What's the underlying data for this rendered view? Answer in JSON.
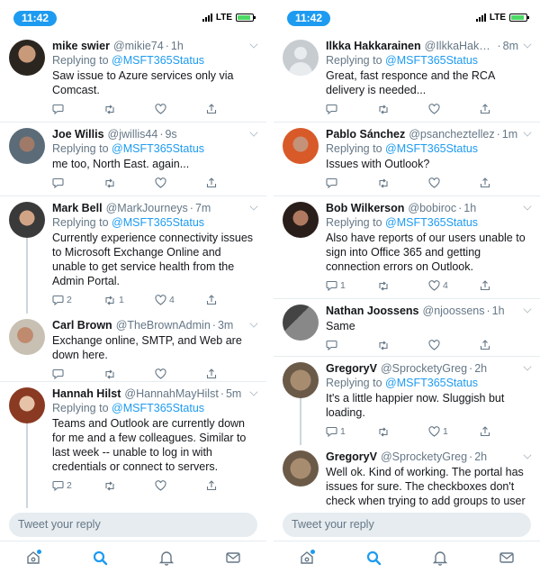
{
  "status": {
    "time": "11:42",
    "network": "LTE",
    "battery_level": 0.9
  },
  "colors": {
    "accent": "#1d9bf0",
    "muted": "#657786",
    "text": "#14171a",
    "divider": "#e6ecf0"
  },
  "left": {
    "tweets": [
      {
        "name": "mike swier",
        "handle": "@mikie74",
        "age": "1h",
        "replying_prefix": "Replying to",
        "mention": "@MSFT365Status",
        "text": "Saw issue to Azure services only via Comcast.",
        "counts": {
          "reply": "",
          "retweet": "",
          "like": ""
        }
      },
      {
        "name": "Joe Willis",
        "handle": "@jwillis44",
        "age": "9s",
        "replying_prefix": "Replying to",
        "mention": "@MSFT365Status",
        "text": "me too, North East. again...",
        "counts": {
          "reply": "",
          "retweet": "",
          "like": ""
        }
      },
      {
        "name": "Mark Bell",
        "handle": "@MarkJourneys",
        "age": "7m",
        "replying_prefix": "Replying to",
        "mention": "@MSFT365Status",
        "text": "Currently experience connectivity issues to Microsoft Exchange Online and unable to get service health from the Admin Portal.",
        "counts": {
          "reply": "2",
          "retweet": "1",
          "like": "4"
        }
      },
      {
        "name": "Carl Brown",
        "handle": "@TheBrownAdmin",
        "age": "3m",
        "replying_prefix": "",
        "mention": "",
        "text": "Exchange online, SMTP, and Web are down here.",
        "counts": {
          "reply": "",
          "retweet": "",
          "like": ""
        }
      },
      {
        "name": "Hannah Hilst",
        "handle": "@HannahMayHilst",
        "age": "5m",
        "replying_prefix": "Replying to",
        "mention": "@MSFT365Status",
        "text": "Teams and Outlook are currently down for me and a few colleagues. Similar to last week -- unable to log in with credentials or connect to servers.",
        "counts": {
          "reply": "2",
          "retweet": "",
          "like": ""
        }
      }
    ],
    "composer_placeholder": "Tweet your reply"
  },
  "right": {
    "tweets": [
      {
        "name": "Ilkka Hakkarainen",
        "handle": "@IlkkaHakkara...",
        "age": "8m",
        "replying_prefix": "Replying to",
        "mention": "@MSFT365Status",
        "text": "Great, fast responce and the RCA delivery is needed...",
        "counts": {
          "reply": "",
          "retweet": "",
          "like": ""
        }
      },
      {
        "name": "Pablo Sánchez",
        "handle": "@psancheztellez",
        "age": "1m",
        "replying_prefix": "Replying to",
        "mention": "@MSFT365Status",
        "text": "Issues with Outlook?",
        "counts": {
          "reply": "",
          "retweet": "",
          "like": ""
        }
      },
      {
        "name": "Bob Wilkerson",
        "handle": "@bobiroc",
        "age": "1h",
        "replying_prefix": "Replying to",
        "mention": "@MSFT365Status",
        "text": "Also have reports of our users unable to sign into Office 365 and getting connection errors on Outlook.",
        "counts": {
          "reply": "1",
          "retweet": "",
          "like": "4"
        }
      },
      {
        "name": "Nathan Joossens",
        "handle": "@njoossens",
        "age": "1h",
        "replying_prefix": "",
        "mention": "",
        "text": "Same",
        "counts": {
          "reply": "",
          "retweet": "",
          "like": ""
        }
      },
      {
        "name": "GregoryV",
        "handle": "@SprocketyGreg",
        "age": "2h",
        "replying_prefix": "Replying to",
        "mention": "@MSFT365Status",
        "text": "It's a little happier now. Sluggish but loading.",
        "counts": {
          "reply": "1",
          "retweet": "",
          "like": "1"
        }
      },
      {
        "name": "GregoryV",
        "handle": "@SprocketyGreg",
        "age": "2h",
        "replying_prefix": "",
        "mention": "",
        "text": "Well ok. Kind of working. The portal has issues for sure. The checkboxes don't check when trying to add groups to user",
        "counts": {
          "reply": "",
          "retweet": "",
          "like": ""
        }
      }
    ],
    "composer_placeholder": "Tweet your reply"
  },
  "tabs": [
    {
      "icon": "home-icon",
      "active": false,
      "has_dot": true
    },
    {
      "icon": "search-icon",
      "active": true,
      "has_dot": false
    },
    {
      "icon": "notifications-icon",
      "active": false,
      "has_dot": false
    },
    {
      "icon": "messages-icon",
      "active": false,
      "has_dot": false
    }
  ]
}
